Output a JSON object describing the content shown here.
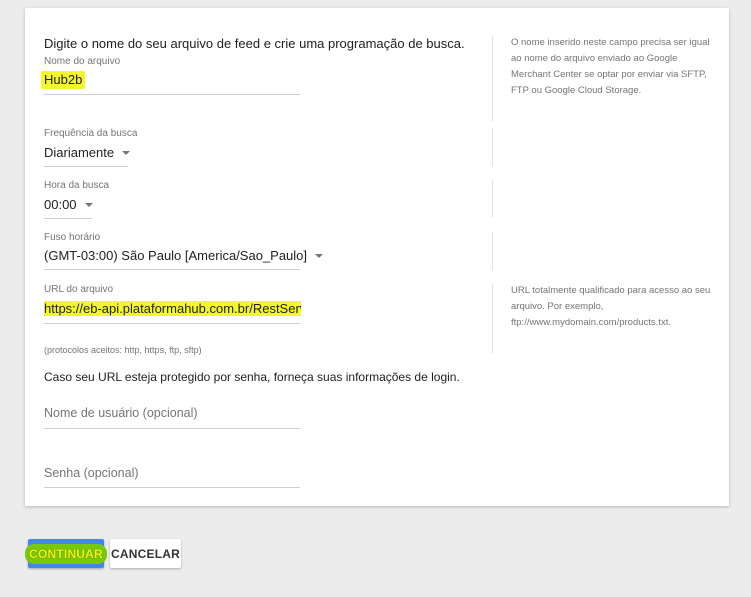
{
  "form": {
    "intro": "Digite o nome do seu arquivo de feed e crie uma programação de busca.",
    "file_name": {
      "label": "Nome do arquivo",
      "value": "Hub2b"
    },
    "frequency": {
      "label": "Frequência da busca",
      "value": "Diariamente"
    },
    "fetch_time": {
      "label": "Hora da busca",
      "value": "00:00"
    },
    "timezone": {
      "label": "Fuso horário",
      "value": "(GMT-03:00) São Paulo [America/Sao_Paulo]"
    },
    "file_url": {
      "label": "URL do arquivo",
      "value": "https://eb-api.plataformahub.com.br/RestServic"
    },
    "protocols_note": "(protocolos aceitos: http, https, ftp, sftp)",
    "login_note": "Caso seu URL esteja protegido por senha, forneça suas informações de login.",
    "username": {
      "placeholder": "Nome de usuário (opcional)"
    },
    "password": {
      "placeholder": "Senha (opcional)"
    }
  },
  "help": {
    "file_name": "O nome inserido neste campo precisa ser igual ao nome do arquivo enviado ao Google Merchant Center se optar por enviar via SFTP, FTP ou Google Cloud Storage.",
    "file_url": "URL totalmente qualificado para acesso ao seu arquivo. Por exemplo, ftp://www.mydomain.com/products.txt."
  },
  "actions": {
    "continue": "CONTINUAR",
    "cancel": "CANCELAR"
  },
  "colors": {
    "primary": "#4285f4",
    "highlight": "#f4f72a"
  },
  "icons": {
    "dropdown": "caret-down-icon"
  }
}
